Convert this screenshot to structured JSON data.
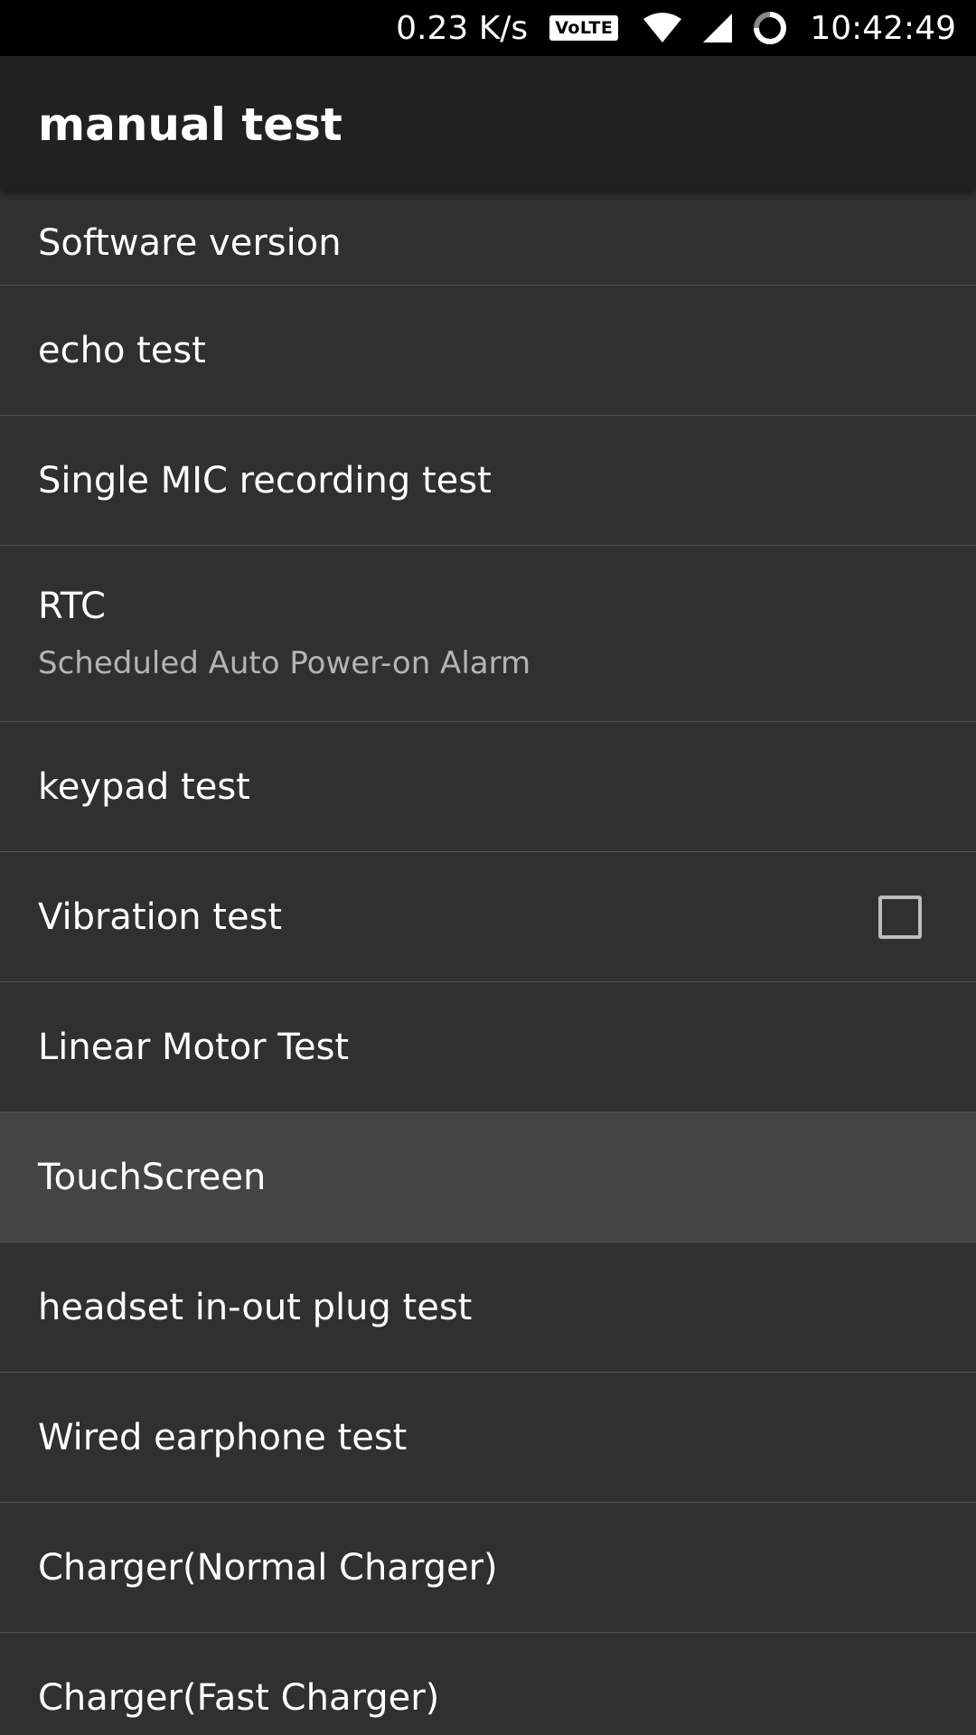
{
  "status_bar": {
    "net_speed": "0.23 K/s",
    "volte_badge": "VoLTE",
    "time": "10:42:49",
    "icons": [
      "volte-icon",
      "wifi-icon",
      "cell-signal-icon",
      "sync-icon"
    ]
  },
  "app_bar": {
    "title": "manual test"
  },
  "list": {
    "items": [
      {
        "label": "Software version"
      },
      {
        "label": "echo test"
      },
      {
        "label": "Single MIC recording test"
      },
      {
        "label": "RTC",
        "summary": "Scheduled Auto Power-on Alarm"
      },
      {
        "label": "keypad test"
      },
      {
        "label": "Vibration test",
        "checkbox_checked": false
      },
      {
        "label": "Linear Motor Test"
      },
      {
        "label": "TouchScreen",
        "pressed": true
      },
      {
        "label": "headset in-out plug test"
      },
      {
        "label": "Wired earphone test"
      },
      {
        "label": "Charger(Normal Charger)"
      },
      {
        "label": "Charger(Fast Charger)"
      }
    ]
  },
  "colors": {
    "background": "#303030",
    "app_bar": "#212121",
    "status_bar": "#000000",
    "divider": "#505050",
    "pressed_row": "#444444",
    "summary_text": "#b4b4b4"
  }
}
